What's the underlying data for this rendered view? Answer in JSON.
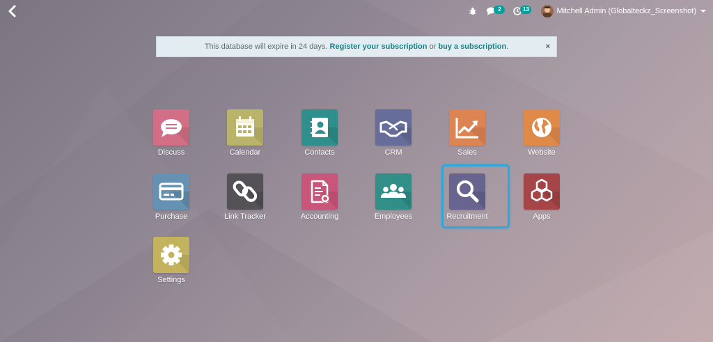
{
  "topbar": {
    "back_icon": "chevron-left-icon",
    "bug_icon": "bug-icon",
    "messages": {
      "icon": "chat-icon",
      "count": "2"
    },
    "activities": {
      "icon": "clock-icon",
      "count": "13"
    },
    "user": {
      "name": "Mitchell Admin (Globalteckz_Screenshot)"
    }
  },
  "banner": {
    "prefix": "This database will expire in 24 days.",
    "register_link": "Register your subscription",
    "middle": "or",
    "buy_link": "buy a subscription",
    "suffix": ".",
    "close": "×"
  },
  "apps": [
    {
      "label": "Discuss",
      "icon": "chat-bubble-icon",
      "color": "#d26e86"
    },
    {
      "label": "Calendar",
      "icon": "calendar-icon",
      "color": "#bab36a"
    },
    {
      "label": "Contacts",
      "icon": "address-book-icon",
      "color": "#2f8f8c"
    },
    {
      "label": "CRM",
      "icon": "handshake-icon",
      "color": "#676d9a"
    },
    {
      "label": "Sales",
      "icon": "line-chart-icon",
      "color": "#dd8453"
    },
    {
      "label": "Website",
      "icon": "globe-icon",
      "color": "#e08a4a"
    },
    {
      "label": "Purchase",
      "icon": "credit-card-icon",
      "color": "#6592b2"
    },
    {
      "label": "Link Tracker",
      "icon": "link-icon",
      "color": "#555257"
    },
    {
      "label": "Accounting",
      "icon": "invoice-icon",
      "color": "#c8567a"
    },
    {
      "label": "Employees",
      "icon": "people-icon",
      "color": "#318f88"
    },
    {
      "label": "Recruitment",
      "icon": "magnifier-icon",
      "color": "#67658f"
    },
    {
      "label": "Apps",
      "icon": "cubes-icon",
      "color": "#a64547"
    },
    {
      "label": "Settings",
      "icon": "gear-icon",
      "color": "#c3b35e"
    }
  ]
}
